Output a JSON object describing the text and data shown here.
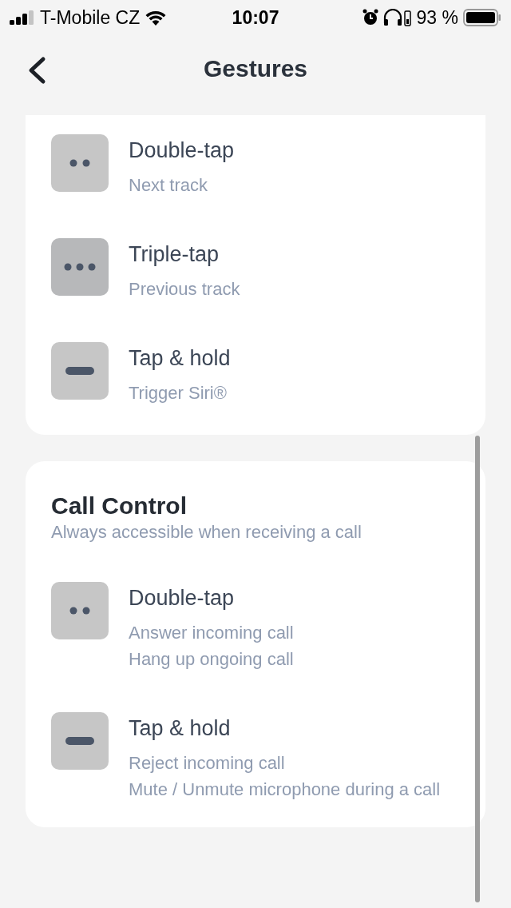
{
  "status_bar": {
    "carrier": "T-Mobile CZ",
    "time": "10:07",
    "battery": "93 %"
  },
  "header": {
    "title": "Gestures"
  },
  "sections": [
    {
      "gestures": [
        {
          "kind": "double",
          "selected": false,
          "title": "Double-tap",
          "lines": [
            "Next track"
          ]
        },
        {
          "kind": "triple",
          "selected": true,
          "title": "Triple-tap",
          "lines": [
            "Previous track"
          ]
        },
        {
          "kind": "hold",
          "selected": false,
          "title": "Tap & hold",
          "lines": [
            "Trigger Siri®"
          ]
        }
      ]
    },
    {
      "title": "Call Control",
      "subtitle": "Always accessible when receiving a call",
      "gestures": [
        {
          "kind": "double",
          "selected": false,
          "title": "Double-tap",
          "lines": [
            "Answer incoming call",
            "Hang up ongoing call"
          ]
        },
        {
          "kind": "hold",
          "selected": false,
          "title": "Tap & hold",
          "lines": [
            "Reject incoming call",
            "Mute / Unmute microphone during a call"
          ]
        }
      ]
    }
  ]
}
